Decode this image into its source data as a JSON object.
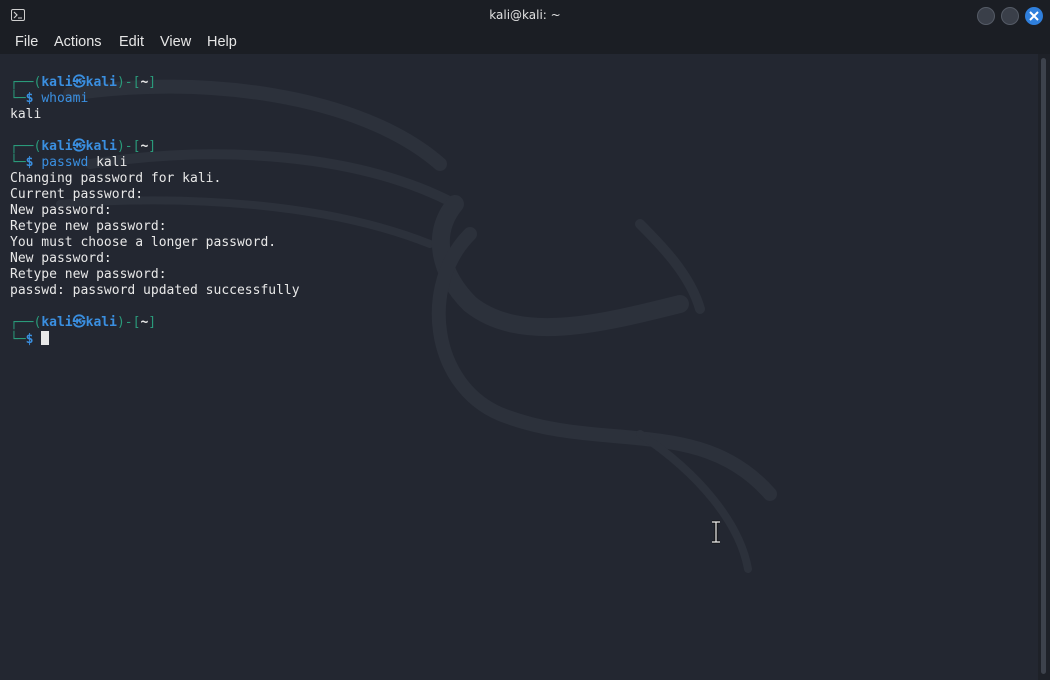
{
  "window": {
    "title": "kali@kali: ~"
  },
  "menu": [
    "File",
    "Actions",
    "Edit",
    "View",
    "Help"
  ],
  "prompt": {
    "user": "kali",
    "host": "kali",
    "at_symbol": "㉿",
    "dir": "~",
    "symbol": "$"
  },
  "commands": {
    "c1": "whoami",
    "c2_cmd": "passwd",
    "c2_arg": "kali"
  },
  "output": {
    "whoami": "kali",
    "passwd": [
      "Changing password for kali.",
      "Current password:",
      "New password:",
      "Retype new password:",
      "You must choose a longer password.",
      "New password:",
      "Retype new password:",
      "passwd: password updated successfully"
    ]
  },
  "colors": {
    "accent": "#2f7fdc",
    "prompt_blue": "#3a8fe0",
    "frame_teal": "#2a9a7a",
    "background": "#232731"
  }
}
